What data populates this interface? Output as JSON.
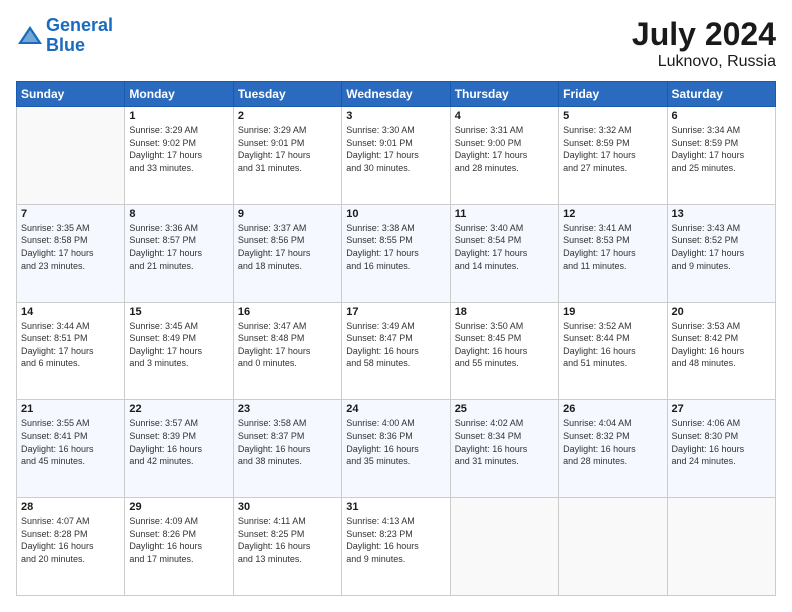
{
  "header": {
    "logo_line1": "General",
    "logo_line2": "Blue",
    "month_year": "July 2024",
    "location": "Luknovo, Russia"
  },
  "days_of_week": [
    "Sunday",
    "Monday",
    "Tuesday",
    "Wednesday",
    "Thursday",
    "Friday",
    "Saturday"
  ],
  "weeks": [
    [
      {
        "day": "",
        "info": ""
      },
      {
        "day": "1",
        "info": "Sunrise: 3:29 AM\nSunset: 9:02 PM\nDaylight: 17 hours\nand 33 minutes."
      },
      {
        "day": "2",
        "info": "Sunrise: 3:29 AM\nSunset: 9:01 PM\nDaylight: 17 hours\nand 31 minutes."
      },
      {
        "day": "3",
        "info": "Sunrise: 3:30 AM\nSunset: 9:01 PM\nDaylight: 17 hours\nand 30 minutes."
      },
      {
        "day": "4",
        "info": "Sunrise: 3:31 AM\nSunset: 9:00 PM\nDaylight: 17 hours\nand 28 minutes."
      },
      {
        "day": "5",
        "info": "Sunrise: 3:32 AM\nSunset: 8:59 PM\nDaylight: 17 hours\nand 27 minutes."
      },
      {
        "day": "6",
        "info": "Sunrise: 3:34 AM\nSunset: 8:59 PM\nDaylight: 17 hours\nand 25 minutes."
      }
    ],
    [
      {
        "day": "7",
        "info": "Sunrise: 3:35 AM\nSunset: 8:58 PM\nDaylight: 17 hours\nand 23 minutes."
      },
      {
        "day": "8",
        "info": "Sunrise: 3:36 AM\nSunset: 8:57 PM\nDaylight: 17 hours\nand 21 minutes."
      },
      {
        "day": "9",
        "info": "Sunrise: 3:37 AM\nSunset: 8:56 PM\nDaylight: 17 hours\nand 18 minutes."
      },
      {
        "day": "10",
        "info": "Sunrise: 3:38 AM\nSunset: 8:55 PM\nDaylight: 17 hours\nand 16 minutes."
      },
      {
        "day": "11",
        "info": "Sunrise: 3:40 AM\nSunset: 8:54 PM\nDaylight: 17 hours\nand 14 minutes."
      },
      {
        "day": "12",
        "info": "Sunrise: 3:41 AM\nSunset: 8:53 PM\nDaylight: 17 hours\nand 11 minutes."
      },
      {
        "day": "13",
        "info": "Sunrise: 3:43 AM\nSunset: 8:52 PM\nDaylight: 17 hours\nand 9 minutes."
      }
    ],
    [
      {
        "day": "14",
        "info": "Sunrise: 3:44 AM\nSunset: 8:51 PM\nDaylight: 17 hours\nand 6 minutes."
      },
      {
        "day": "15",
        "info": "Sunrise: 3:45 AM\nSunset: 8:49 PM\nDaylight: 17 hours\nand 3 minutes."
      },
      {
        "day": "16",
        "info": "Sunrise: 3:47 AM\nSunset: 8:48 PM\nDaylight: 17 hours\nand 0 minutes."
      },
      {
        "day": "17",
        "info": "Sunrise: 3:49 AM\nSunset: 8:47 PM\nDaylight: 16 hours\nand 58 minutes."
      },
      {
        "day": "18",
        "info": "Sunrise: 3:50 AM\nSunset: 8:45 PM\nDaylight: 16 hours\nand 55 minutes."
      },
      {
        "day": "19",
        "info": "Sunrise: 3:52 AM\nSunset: 8:44 PM\nDaylight: 16 hours\nand 51 minutes."
      },
      {
        "day": "20",
        "info": "Sunrise: 3:53 AM\nSunset: 8:42 PM\nDaylight: 16 hours\nand 48 minutes."
      }
    ],
    [
      {
        "day": "21",
        "info": "Sunrise: 3:55 AM\nSunset: 8:41 PM\nDaylight: 16 hours\nand 45 minutes."
      },
      {
        "day": "22",
        "info": "Sunrise: 3:57 AM\nSunset: 8:39 PM\nDaylight: 16 hours\nand 42 minutes."
      },
      {
        "day": "23",
        "info": "Sunrise: 3:58 AM\nSunset: 8:37 PM\nDaylight: 16 hours\nand 38 minutes."
      },
      {
        "day": "24",
        "info": "Sunrise: 4:00 AM\nSunset: 8:36 PM\nDaylight: 16 hours\nand 35 minutes."
      },
      {
        "day": "25",
        "info": "Sunrise: 4:02 AM\nSunset: 8:34 PM\nDaylight: 16 hours\nand 31 minutes."
      },
      {
        "day": "26",
        "info": "Sunrise: 4:04 AM\nSunset: 8:32 PM\nDaylight: 16 hours\nand 28 minutes."
      },
      {
        "day": "27",
        "info": "Sunrise: 4:06 AM\nSunset: 8:30 PM\nDaylight: 16 hours\nand 24 minutes."
      }
    ],
    [
      {
        "day": "28",
        "info": "Sunrise: 4:07 AM\nSunset: 8:28 PM\nDaylight: 16 hours\nand 20 minutes."
      },
      {
        "day": "29",
        "info": "Sunrise: 4:09 AM\nSunset: 8:26 PM\nDaylight: 16 hours\nand 17 minutes."
      },
      {
        "day": "30",
        "info": "Sunrise: 4:11 AM\nSunset: 8:25 PM\nDaylight: 16 hours\nand 13 minutes."
      },
      {
        "day": "31",
        "info": "Sunrise: 4:13 AM\nSunset: 8:23 PM\nDaylight: 16 hours\nand 9 minutes."
      },
      {
        "day": "",
        "info": ""
      },
      {
        "day": "",
        "info": ""
      },
      {
        "day": "",
        "info": ""
      }
    ]
  ]
}
